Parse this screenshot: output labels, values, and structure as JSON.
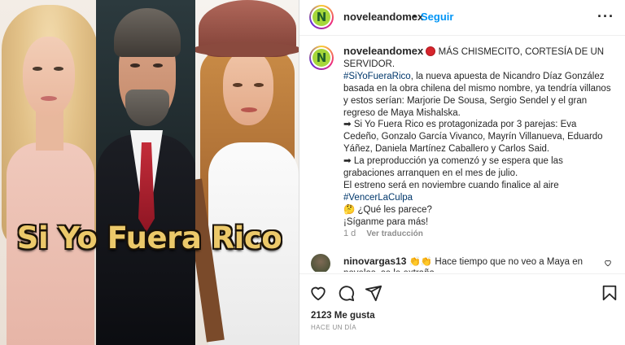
{
  "media": {
    "overlay_title": "Si Yo Fuera Rico"
  },
  "header": {
    "avatar_letter": "N",
    "username": "noveleandomex",
    "separator": "•",
    "follow_label": "Seguir",
    "more_label": "···"
  },
  "caption": {
    "username": "noveleandomex",
    "line_intro": "MÁS CHISMECITO, CORTESÍA DE UN SERVIDOR.",
    "hashtag1": "#SiYoFueraRico",
    "para1": ", la nueva apuesta de Nicandro Díaz González basada en la obra chilena del mismo nombre, ya tendría villanos y estos serían: Marjorie De Sousa, Sergio Sendel y el gran regreso de Maya Mishalska.",
    "para2": "➡ Si Yo Fuera Rico es protagonizada por 3 parejas: Eva Cedeño, Gonzalo García Vivanco, Mayrín Villanueva, Eduardo Yáñez, Daniela Martínez Caballero y Carlos Said.",
    "para3": "➡ La preproducción ya comenzó y se espera que las grabaciones arranquen en el mes de julio.",
    "para4": "El estreno será en noviembre cuando finalice al aire",
    "hashtag2": "#VencerLaCulpa",
    "para5": "🤔 ¿Qué les parece?",
    "para6": "¡Síganme para más!",
    "time": "1 d",
    "translate_label": "Ver traducción"
  },
  "comment": {
    "username": "ninovargas13",
    "emoji": "👏👏",
    "text": "Hace tiempo que no veo a Maya en novelas, se le extraña"
  },
  "footer": {
    "likes": "2123 Me gusta",
    "posted": "HACE UN DÍA"
  },
  "icons": [
    "heart-icon",
    "comment-icon",
    "share-icon",
    "bookmark-icon",
    "more-icon"
  ],
  "colors": {
    "link": "#0095f6",
    "hashtag": "#00376b",
    "muted": "#8e8e8e",
    "title_gold": "#ecc96a"
  }
}
